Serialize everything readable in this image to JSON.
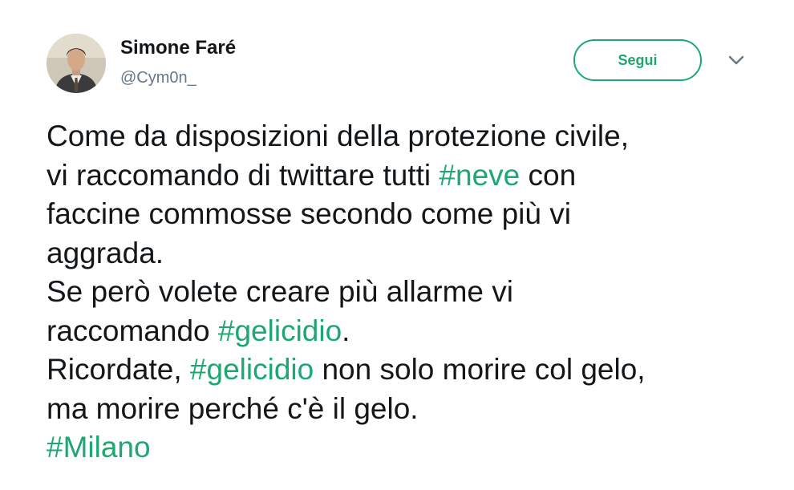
{
  "user": {
    "display_name": "Simone Faré",
    "handle": "@Cym0n_"
  },
  "actions": {
    "follow_label": "Segui",
    "more_icon": "chevron-down-icon"
  },
  "colors": {
    "accent": "#1da872",
    "text": "#14171a",
    "secondary": "#657786"
  },
  "tweet": {
    "lines": [
      [
        {
          "t": "Come da disposizioni della protezione civile,"
        }
      ],
      [
        {
          "t": "vi raccomando di twittare tutti "
        },
        {
          "t": "#neve",
          "tag": true
        },
        {
          "t": " con"
        }
      ],
      [
        {
          "t": "faccine commosse secondo come più vi"
        }
      ],
      [
        {
          "t": "aggrada."
        }
      ],
      [
        {
          "t": "Se però volete creare più allarme vi"
        }
      ],
      [
        {
          "t": "raccomando "
        },
        {
          "t": "#gelicidio",
          "tag": true
        },
        {
          "t": "."
        }
      ],
      [
        {
          "t": "Ricordate, "
        },
        {
          "t": "#gelicidio",
          "tag": true
        },
        {
          "t": " non solo morire col gelo,"
        }
      ],
      [
        {
          "t": "ma morire perché c'è il gelo."
        }
      ],
      [
        {
          "t": "#Milano",
          "tag": true
        }
      ]
    ]
  }
}
